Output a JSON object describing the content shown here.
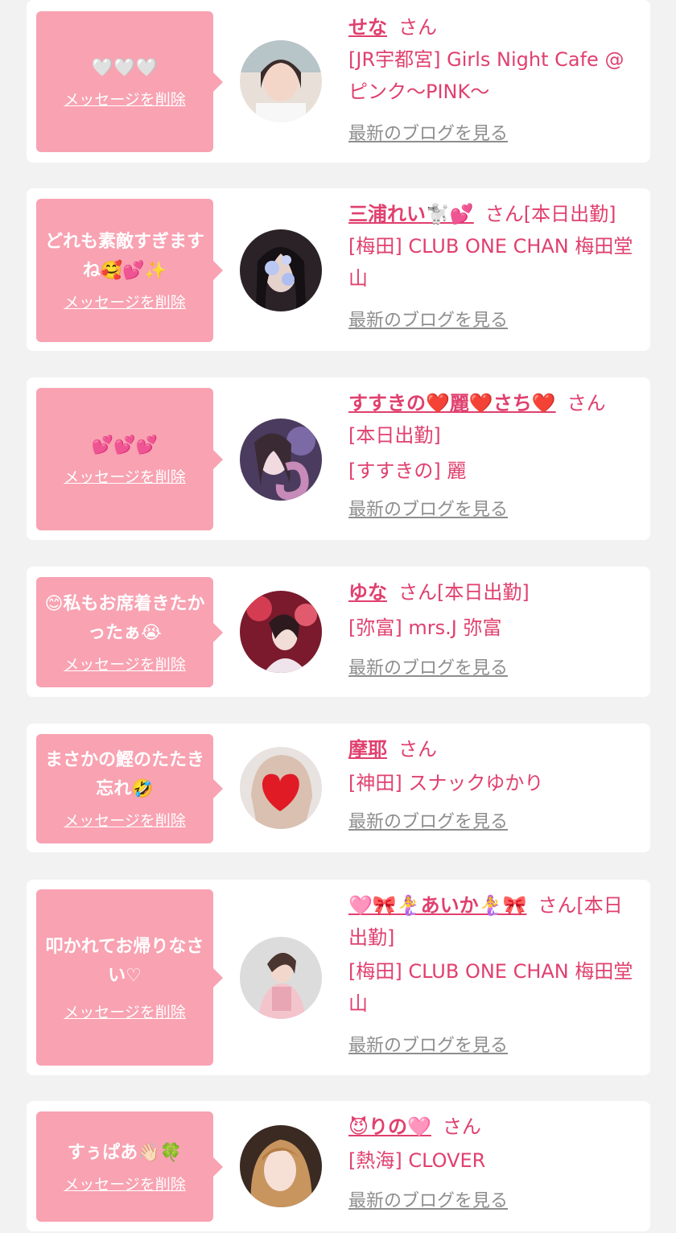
{
  "common": {
    "delete_label": "メッセージを削除",
    "blog_label": "最新のブログを見る",
    "san": "さん"
  },
  "cards": [
    {
      "message": "🤍🤍🤍",
      "name": "せな",
      "suffix": "さん",
      "shop": "[JR宇都宮] Girls Night Cafe @ピンク〜PINK〜"
    },
    {
      "message": "どれも素敵すぎますね🥰💕✨",
      "name": "三浦れい🐩💕",
      "suffix": "さん[本日出勤]",
      "shop": "[梅田] CLUB ONE CHAN 梅田堂山"
    },
    {
      "message": "💕💕💕",
      "name": "すすきの❤️麗❤️さち❤️",
      "suffix": "さん",
      "shop_prefix": "[本日出勤]",
      "shop": "[すすきの] 麗"
    },
    {
      "message": "😊私もお席着きたかったぁ😭",
      "name": "ゆな",
      "suffix": "さん[本日出勤]",
      "shop": "[弥富] mrs.J 弥富"
    },
    {
      "message": "まさかの鰹のたたき忘れ🤣",
      "name": "摩耶",
      "suffix": "さん",
      "shop": "[神田] スナックゆかり"
    },
    {
      "message": "叩かれてお帰りなさい♡",
      "name": "🩷🎀🧜‍♀️あいか🧜‍♀️🎀",
      "suffix": "さん[本日出勤]",
      "shop": "[梅田] CLUB ONE CHAN 梅田堂山"
    },
    {
      "message": "すぅぱあ👋🏻🍀",
      "name": "😈りの🩷",
      "suffix": "さん",
      "shop": "[熱海] CLOVER"
    }
  ],
  "colors": {
    "accent": "#e0406e",
    "bubble": "#f8a2b2",
    "link_gray": "#8e8e8e",
    "background": "#f2f2f2"
  }
}
